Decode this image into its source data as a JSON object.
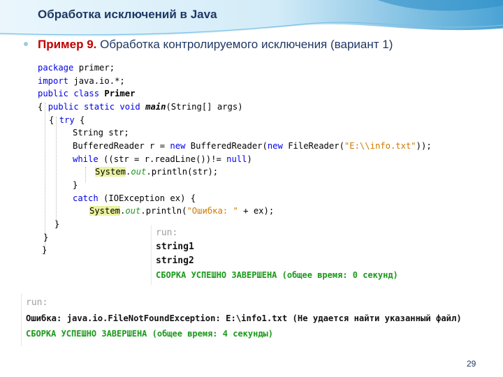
{
  "slide": {
    "title": "Обработка исключений в Java",
    "bullet_bold": "Пример 9.",
    "bullet_text": " Обработка контролируемого исключения (вариант 1)",
    "page_number": "29"
  },
  "code": {
    "l1_a": "package",
    "l1_b": " primer;",
    "l2_a": "import",
    "l2_b": " java.io.*;",
    "l3_a": "public class",
    "l3_b": " Primer",
    "l4_a": "{ ",
    "l4_b": "public static void",
    "l4_c": " ",
    "l4_d": "main",
    "l4_e": "(String[] args)",
    "l5_a": "{ ",
    "l5_b": "try",
    "l5_c": " {",
    "l6": "String str;",
    "l7_a": "BufferedReader r = ",
    "l7_b": "new",
    "l7_c": " BufferedReader(",
    "l7_d": "new",
    "l7_e": " FileReader(",
    "l7_f": "\"E:\\\\info.txt\"",
    "l7_g": "));",
    "l8_a": "while",
    "l8_b": " ((str = r.readLine())!= ",
    "l8_c": "null",
    "l8_d": ")",
    "l9_a": "System",
    "l9_b": ".",
    "l9_c": "out",
    "l9_d": ".println(str);",
    "l10": "}",
    "l11_a": "catch",
    "l11_b": " (IOException ex) {",
    "l12_a": "System",
    "l12_b": ".",
    "l12_c": "out",
    "l12_d": ".println(",
    "l12_e": "\"Ошибка: \"",
    "l12_f": " + ex);",
    "l13": "}",
    "l14": "}"
  },
  "output1": {
    "run": "run:",
    "line1": "string1",
    "line2": "string2",
    "success": "СБОРКА УСПЕШНО ЗАВЕРШЕНА (общее время: 0 секунд)"
  },
  "output2": {
    "run": "run:",
    "error": "Ошибка: java.io.FileNotFoundException: E:\\info1.txt (Не удается найти указанный файл)",
    "success": "СБОРКА УСПЕШНО ЗАВЕРШЕНА (общее время: 4 секунды)"
  }
}
